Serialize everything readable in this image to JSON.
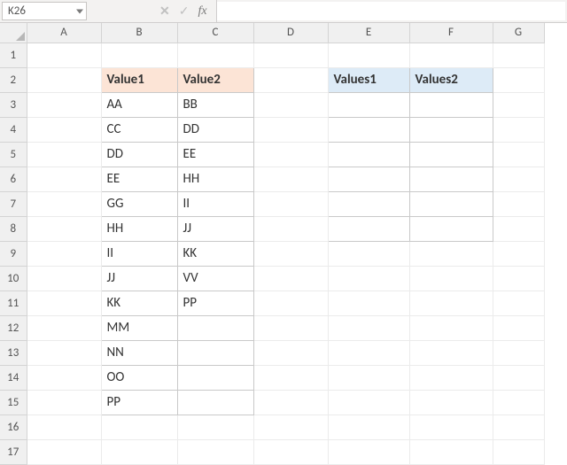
{
  "formula_bar": {
    "name_box": "K26",
    "cancel_glyph": "✕",
    "enter_glyph": "✓",
    "fx_label": "fx",
    "formula_value": ""
  },
  "columns": [
    "A",
    "B",
    "C",
    "D",
    "E",
    "F",
    "G"
  ],
  "row_count": 17,
  "table1": {
    "header1": "Value1",
    "header2": "Value2",
    "rows": [
      [
        "AA",
        "BB"
      ],
      [
        "CC",
        "DD"
      ],
      [
        "DD",
        "EE"
      ],
      [
        "EE",
        "HH"
      ],
      [
        "GG",
        "II"
      ],
      [
        "HH",
        "JJ"
      ],
      [
        "II",
        "KK"
      ],
      [
        "JJ",
        "VV"
      ],
      [
        "KK",
        "PP"
      ],
      [
        "MM",
        ""
      ],
      [
        "NN",
        ""
      ],
      [
        "OO",
        ""
      ],
      [
        "PP",
        ""
      ]
    ]
  },
  "table2": {
    "header1": "Values1",
    "header2": "Values2",
    "rows": [
      [
        "",
        ""
      ],
      [
        "",
        ""
      ],
      [
        "",
        ""
      ],
      [
        "",
        ""
      ],
      [
        "",
        ""
      ],
      [
        "",
        ""
      ]
    ]
  },
  "chart_data": {
    "type": "table",
    "title": "Two spreadsheet ranges",
    "tables": [
      {
        "name": "Value1/Value2",
        "location": "B2:C15",
        "columns": [
          "Value1",
          "Value2"
        ],
        "rows": [
          [
            "AA",
            "BB"
          ],
          [
            "CC",
            "DD"
          ],
          [
            "DD",
            "EE"
          ],
          [
            "EE",
            "HH"
          ],
          [
            "GG",
            "II"
          ],
          [
            "HH",
            "JJ"
          ],
          [
            "II",
            "KK"
          ],
          [
            "JJ",
            "VV"
          ],
          [
            "KK",
            "PP"
          ],
          [
            "MM",
            ""
          ],
          [
            "NN",
            ""
          ],
          [
            "OO",
            ""
          ],
          [
            "PP",
            ""
          ]
        ]
      },
      {
        "name": "Values1/Values2",
        "location": "E2:F8",
        "columns": [
          "Values1",
          "Values2"
        ],
        "rows": [
          [
            "",
            ""
          ],
          [
            "",
            ""
          ],
          [
            "",
            ""
          ],
          [
            "",
            ""
          ],
          [
            "",
            ""
          ],
          [
            "",
            ""
          ]
        ]
      }
    ]
  }
}
